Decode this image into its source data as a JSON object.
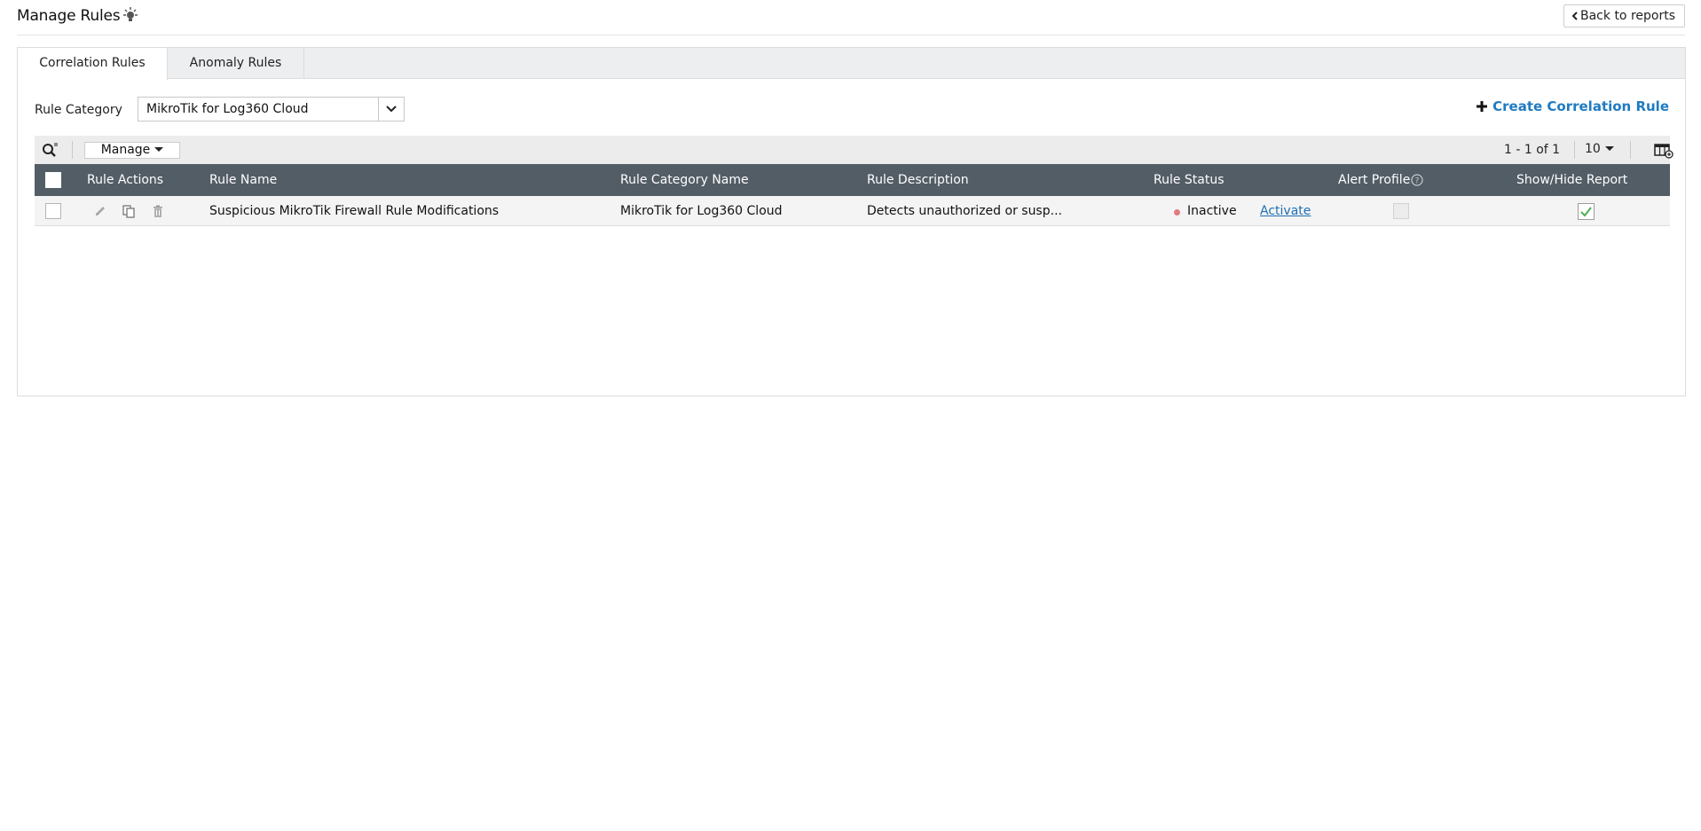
{
  "header": {
    "title": "Manage Rules",
    "back_label": "Back to reports"
  },
  "tabs": [
    {
      "label": "Correlation Rules",
      "active": true
    },
    {
      "label": "Anomaly Rules",
      "active": false
    }
  ],
  "filter": {
    "label": "Rule Category",
    "selected": "MikroTik for Log360 Cloud"
  },
  "create_label": "Create Correlation Rule",
  "toolbar": {
    "manage_label": "Manage",
    "pager": "1 - 1 of 1",
    "page_size": "10"
  },
  "table": {
    "columns": [
      "Rule Actions",
      "Rule Name",
      "Rule Category Name",
      "Rule Description",
      "Rule Status",
      "Alert Profile",
      "Show/Hide Report"
    ],
    "rows": [
      {
        "name": "Suspicious MikroTik Firewall Rule Modifications",
        "category": "MikroTik for Log360 Cloud",
        "description": "Detects unauthorized or susp...",
        "status": "Inactive",
        "action_link": "Activate",
        "alert_profile_enabled": false,
        "show_report": true
      }
    ]
  },
  "colors": {
    "accent": "#1f7bc1",
    "table_header": "#535d66",
    "inactive_dot": "#e07b80",
    "check": "#4caf50"
  }
}
